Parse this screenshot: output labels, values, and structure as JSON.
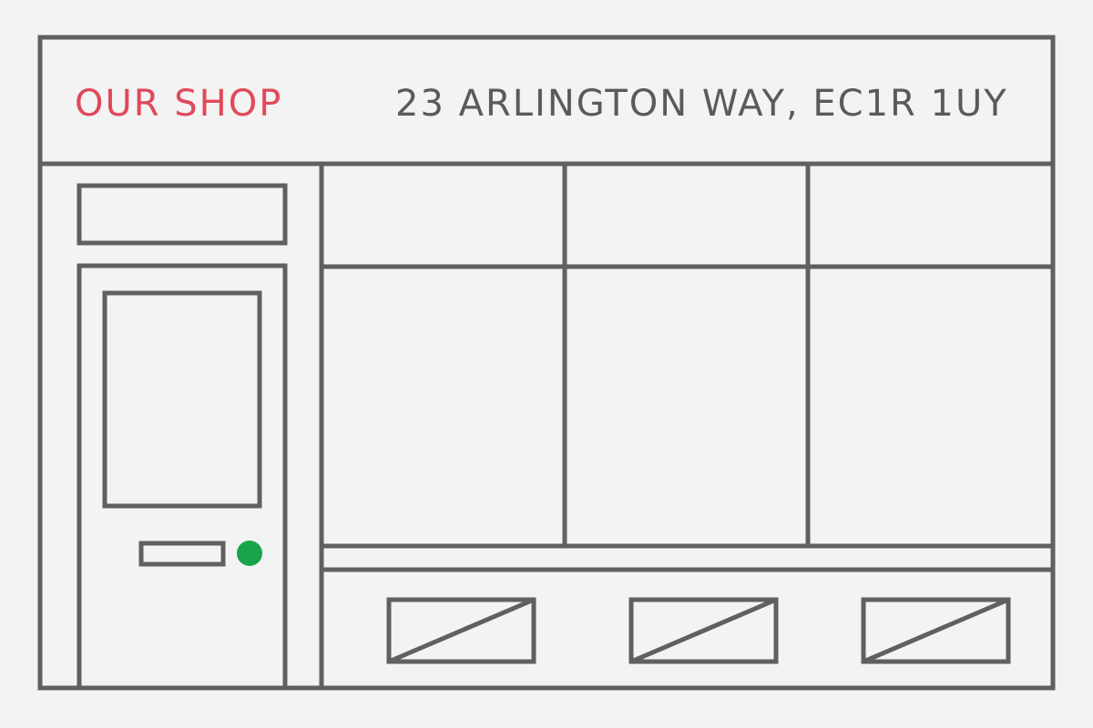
{
  "sign": {
    "name": "OUR SHOP",
    "address": "23 ARLINGTON WAY, EC1R 1UY"
  },
  "colors": {
    "background": "#f3f3f3",
    "line": "#606060",
    "accent": "#e0495b",
    "address_text": "#5a5a5a",
    "door_knob": "#1aa34a"
  },
  "icons": {
    "door_knob": "door-knob-icon",
    "letterbox": "letterbox-icon",
    "vent": "vent-icon"
  }
}
